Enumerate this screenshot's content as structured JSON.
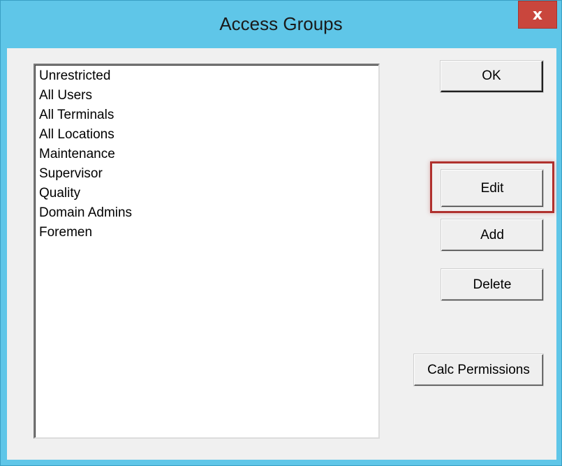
{
  "window": {
    "title": "Access Groups",
    "close_label": "x"
  },
  "list": {
    "items": [
      "Unrestricted",
      "All Users",
      "All Terminals",
      "All Locations",
      "Maintenance",
      "Supervisor",
      "Quality",
      "Domain Admins",
      "Foremen"
    ]
  },
  "buttons": {
    "ok": "OK",
    "edit": "Edit",
    "add": "Add",
    "delete": "Delete",
    "calc_permissions": "Calc Permissions"
  },
  "colors": {
    "titlebar": "#5fc6e8",
    "close_button": "#c9463d",
    "highlight": "#b0312e",
    "client": "#f0f0f0"
  },
  "icons": {
    "close": "close-icon"
  }
}
